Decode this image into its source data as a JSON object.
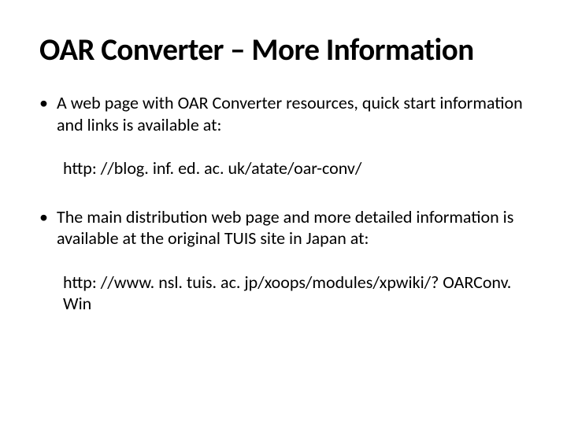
{
  "title": "OAR Converter – More Information",
  "bullets": {
    "b1": "A web page with OAR Converter resources, quick start information and links is available at:",
    "url1": "http: //blog. inf. ed. ac. uk/atate/oar-conv/",
    "b2": "The main distribution web page and more detailed information is available at the original TUIS site in Japan at:",
    "url2": "http: //www. nsl. tuis. ac. jp/xoops/modules/xpwiki/? OARConv. Win"
  }
}
